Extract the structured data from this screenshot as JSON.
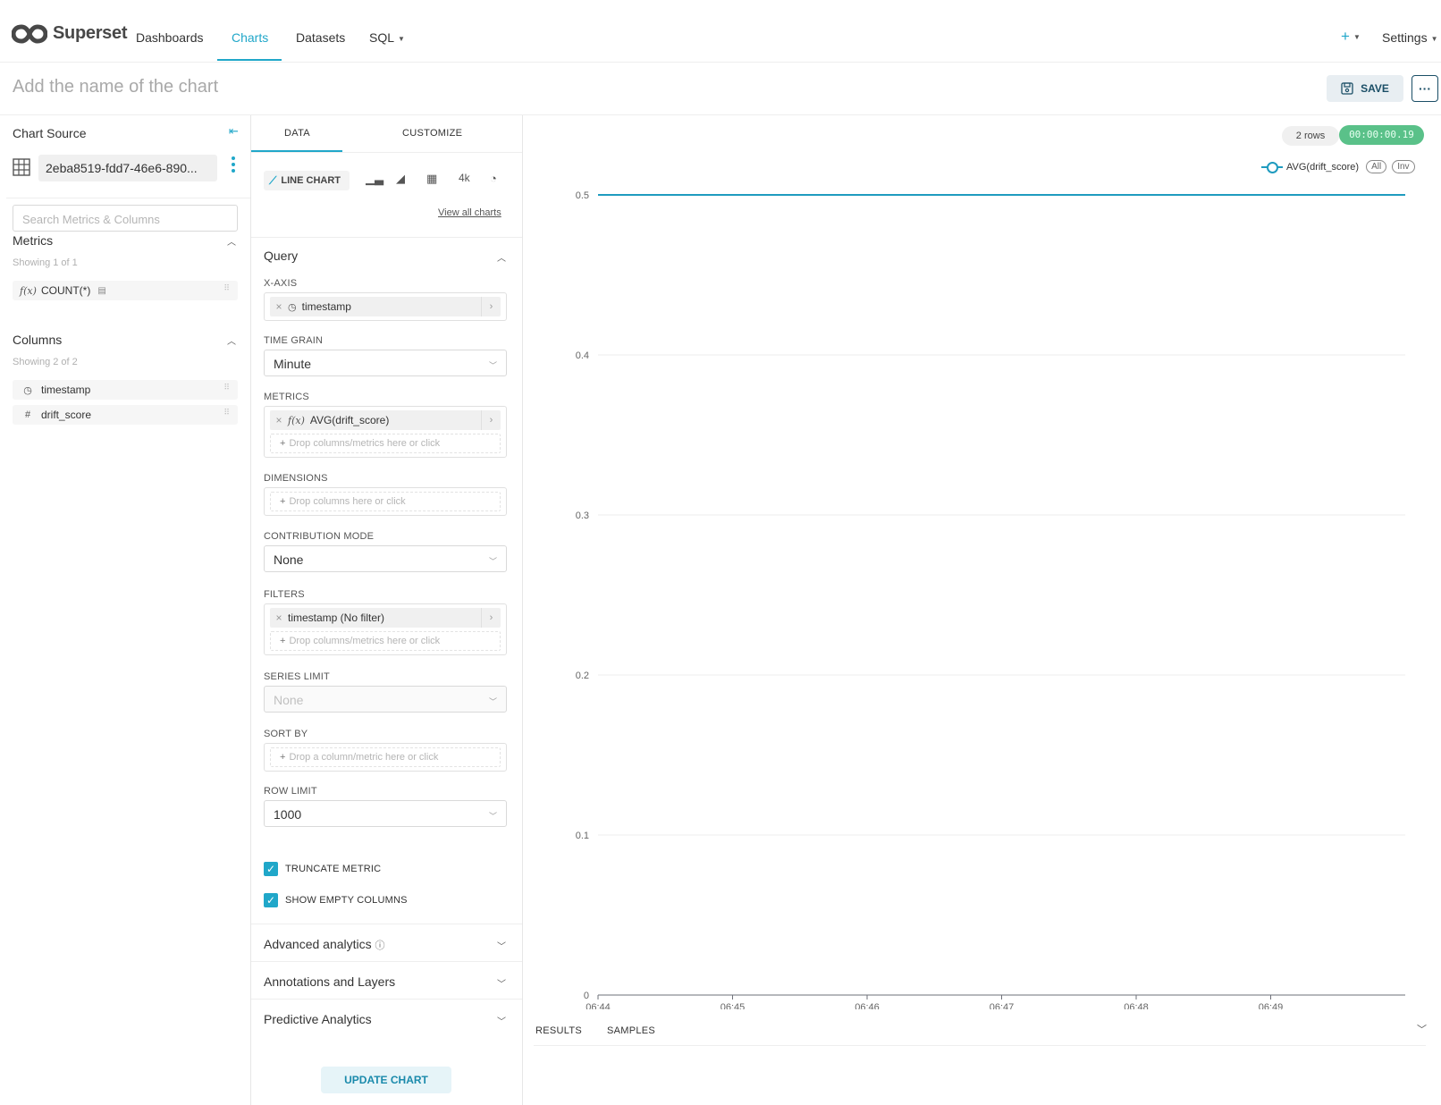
{
  "nav": {
    "brand": "Superset",
    "items": [
      "Dashboards",
      "Charts",
      "Datasets",
      "SQL"
    ],
    "plus": "+",
    "settings": "Settings"
  },
  "header": {
    "title_placeholder": "Add the name of the chart",
    "save_label": "SAVE",
    "more_label": "···"
  },
  "datasource": {
    "title": "Chart Source",
    "name": "2eba8519-fdd7-46e6-890...",
    "search_placeholder": "Search Metrics & Columns",
    "metrics_title": "Metrics",
    "metrics_count": "Showing 1 of 1",
    "metrics": [
      {
        "icon": "function-icon",
        "label": "COUNT(*)"
      }
    ],
    "columns_title": "Columns",
    "columns_count": "Showing 2 of 2",
    "columns": [
      {
        "icon": "clock-icon",
        "label": "timestamp"
      },
      {
        "icon": "hash-icon",
        "label": "drift_score"
      }
    ]
  },
  "controls": {
    "tabs": [
      "DATA",
      "CUSTOMIZE"
    ],
    "viz_type": "LINE CHART",
    "viz_big_number": "4k",
    "view_all_charts": "View all charts",
    "query_title": "Query",
    "x_axis": {
      "label": "X-AXIS",
      "value": "timestamp"
    },
    "time_grain": {
      "label": "TIME GRAIN",
      "value": "Minute"
    },
    "metrics": {
      "label": "METRICS",
      "value": "AVG(drift_score)",
      "drop": "Drop columns/metrics here or click"
    },
    "dimensions": {
      "label": "DIMENSIONS",
      "drop": "Drop columns here or click"
    },
    "contribution_mode": {
      "label": "CONTRIBUTION MODE",
      "value": "None"
    },
    "filters": {
      "label": "FILTERS",
      "value": "timestamp (No filter)",
      "drop": "Drop columns/metrics here or click"
    },
    "series_limit": {
      "label": "SERIES LIMIT",
      "value": "None"
    },
    "sort_by": {
      "label": "SORT BY",
      "drop": "Drop a column/metric here or click"
    },
    "row_limit": {
      "label": "ROW LIMIT",
      "value": "1000"
    },
    "truncate_metric": {
      "label": "TRUNCATE METRIC",
      "checked": true
    },
    "show_empty_columns": {
      "label": "SHOW EMPTY COLUMNS",
      "checked": true
    },
    "sections": [
      "Advanced analytics",
      "Annotations and Layers",
      "Predictive Analytics"
    ],
    "update_label": "UPDATE CHART"
  },
  "chart_meta": {
    "rows": "2 rows",
    "query_time": "00:00:00.19",
    "legend_all": "All",
    "legend_inv": "Inv",
    "result_tabs": [
      "RESULTS",
      "SAMPLES"
    ]
  },
  "chart_data": {
    "type": "line",
    "title": "",
    "xlabel": "",
    "ylabel": "",
    "x_ticks": [
      "06:44",
      "06:45",
      "06:46",
      "06:47",
      "06:48",
      "06:49"
    ],
    "xlim": [
      "06:44",
      "06:50"
    ],
    "ylim": [
      0,
      0.5
    ],
    "y_ticks": [
      0,
      0.1,
      0.2,
      0.3,
      0.4,
      0.5
    ],
    "grid": true,
    "legend_position": "top-right",
    "series": [
      {
        "name": "AVG(drift_score)",
        "color": "#1f9bbf",
        "x": [
          "06:44",
          "06:50"
        ],
        "values": [
          0.5,
          0.5
        ]
      }
    ]
  },
  "colors": {
    "accent": "#20a7c9",
    "success": "#5ac189",
    "primary_dark": "#1a4e66"
  }
}
